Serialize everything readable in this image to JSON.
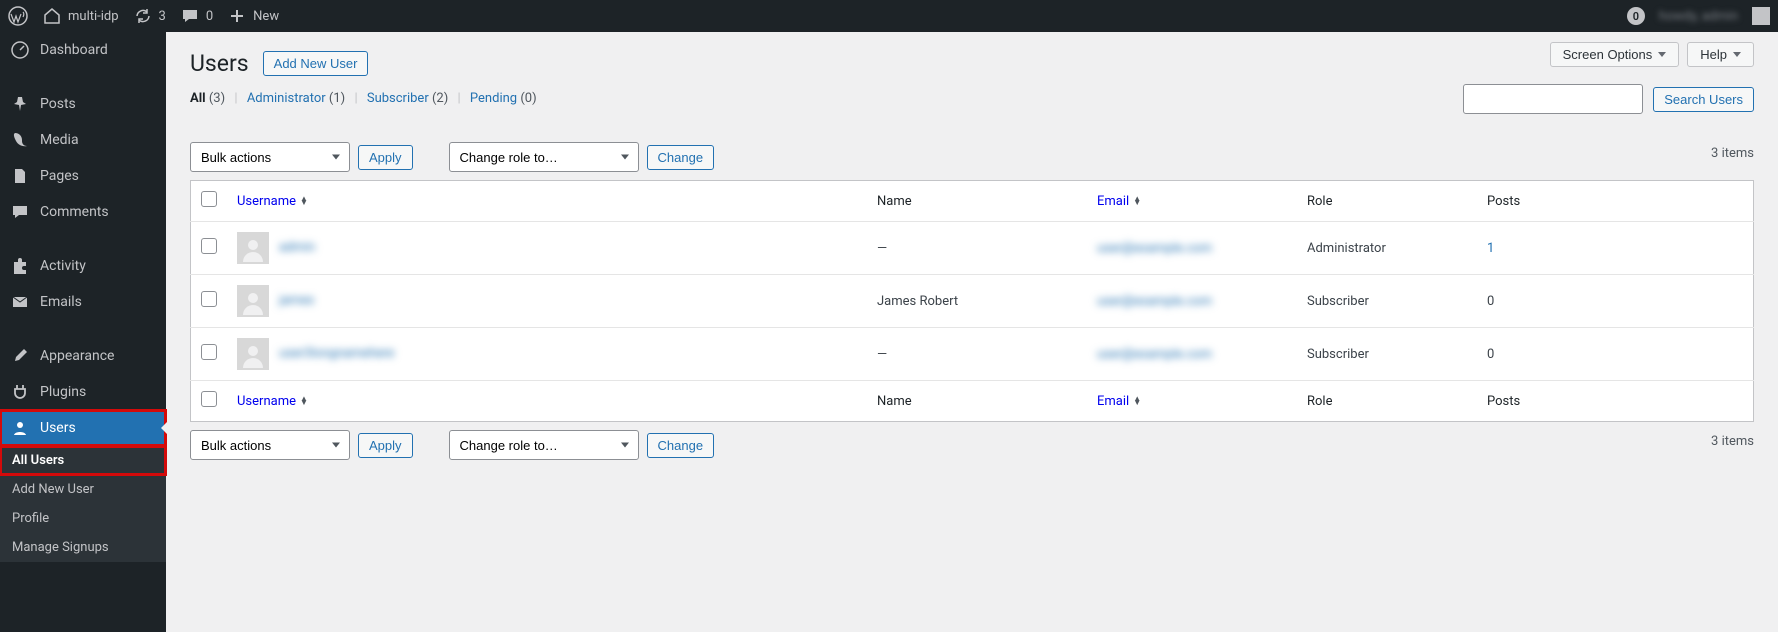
{
  "admin_bar": {
    "site_name": "multi-idp",
    "updates_count": "3",
    "comments_count": "0",
    "new_label": "New",
    "notif_count": "0",
    "user_display": "howdy, admin"
  },
  "sidebar": {
    "items": [
      {
        "id": "dashboard",
        "label": "Dashboard"
      },
      {
        "id": "posts",
        "label": "Posts"
      },
      {
        "id": "media",
        "label": "Media"
      },
      {
        "id": "pages",
        "label": "Pages"
      },
      {
        "id": "comments",
        "label": "Comments"
      },
      {
        "id": "activity",
        "label": "Activity"
      },
      {
        "id": "emails",
        "label": "Emails"
      },
      {
        "id": "appearance",
        "label": "Appearance"
      },
      {
        "id": "plugins",
        "label": "Plugins"
      },
      {
        "id": "users",
        "label": "Users"
      }
    ],
    "users_submenu": [
      {
        "id": "all-users",
        "label": "All Users"
      },
      {
        "id": "add-new-user",
        "label": "Add New User"
      },
      {
        "id": "profile",
        "label": "Profile"
      },
      {
        "id": "manage-signups",
        "label": "Manage Signups"
      }
    ]
  },
  "top": {
    "screen_options": "Screen Options",
    "help": "Help"
  },
  "page": {
    "title": "Users",
    "add_new": "Add New User"
  },
  "filters": {
    "all_label": "All",
    "all_count": "(3)",
    "admin_label": "Administrator",
    "admin_count": "(1)",
    "sub_label": "Subscriber",
    "sub_count": "(2)",
    "pending_label": "Pending",
    "pending_count": "(0)"
  },
  "search": {
    "button": "Search Users"
  },
  "bulk": {
    "bulk_actions": "Bulk actions",
    "apply": "Apply",
    "change_role": "Change role to…",
    "change": "Change"
  },
  "items_count": "3 items",
  "columns": {
    "username": "Username",
    "name": "Name",
    "email": "Email",
    "role": "Role",
    "posts": "Posts"
  },
  "rows": [
    {
      "username": "admin",
      "name": "—",
      "email": "user@example.com",
      "role": "Administrator",
      "posts": "1",
      "posts_link": true
    },
    {
      "username": "james",
      "name": "James Robert",
      "email": "user@example.com",
      "role": "Subscriber",
      "posts": "0",
      "posts_link": false
    },
    {
      "username": "user3longnamehere",
      "name": "—",
      "email": "user@example.com",
      "role": "Subscriber",
      "posts": "0",
      "posts_link": false
    }
  ]
}
